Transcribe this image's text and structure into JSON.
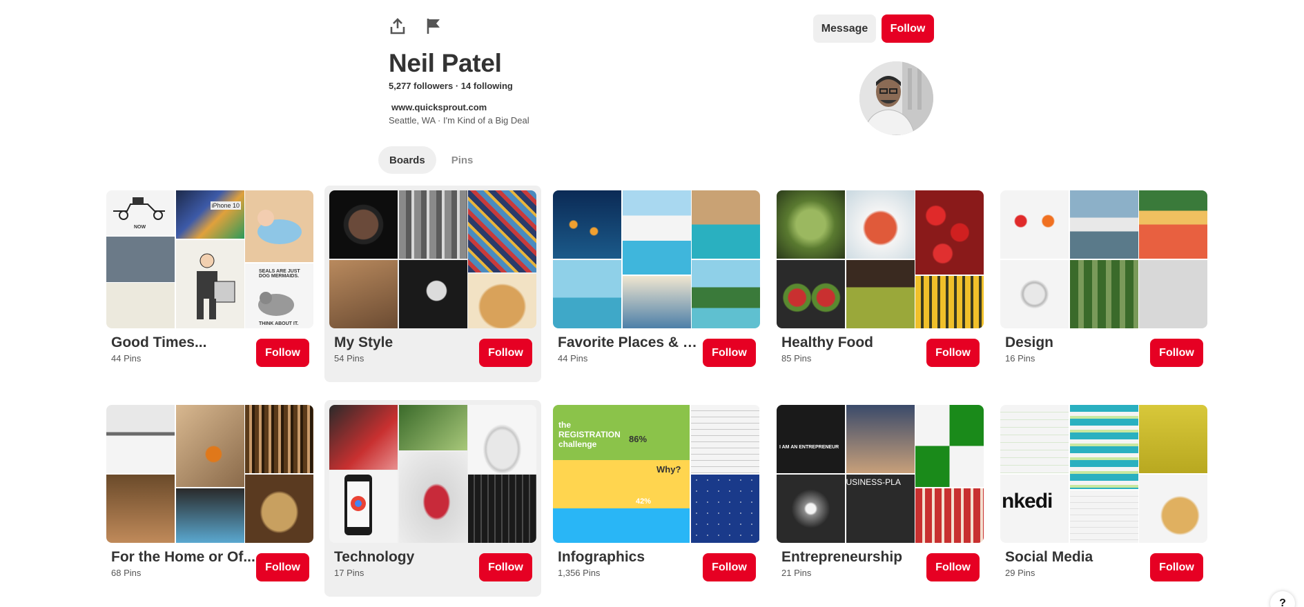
{
  "profile": {
    "name": "Neil Patel",
    "stats": "5,277 followers · 14 following",
    "website": "www.quicksprout.com",
    "location_about": "Seattle, WA  ·  I'm Kind of a Big Deal"
  },
  "header": {
    "share_icon": "share-icon",
    "report_icon": "flag-icon",
    "message_label": "Message",
    "follow_label": "Follow"
  },
  "tabs": [
    {
      "label": "Boards",
      "active": true
    },
    {
      "label": "Pins",
      "active": false
    }
  ],
  "boards": [
    {
      "title": "Good Times...",
      "count": "44 Pins",
      "follow": "Follow",
      "cover_text": [
        "NOW",
        "iPhone 10",
        "SEALS ARE JUST DOG MERMAIDS.",
        "THINK ABOUT IT."
      ]
    },
    {
      "title": "My Style",
      "count": "54 Pins",
      "follow": "Follow"
    },
    {
      "title": "Favorite Places & S...",
      "count": "44 Pins",
      "follow": "Follow"
    },
    {
      "title": "Healthy Food",
      "count": "85 Pins",
      "follow": "Follow"
    },
    {
      "title": "Design",
      "count": "16 Pins",
      "follow": "Follow"
    },
    {
      "title": "For the Home or Of...",
      "count": "68 Pins",
      "follow": "Follow"
    },
    {
      "title": "Technology",
      "count": "17 Pins",
      "follow": "Follow"
    },
    {
      "title": "Infographics",
      "count": "1,356 Pins",
      "follow": "Follow",
      "cover_text": [
        "the REGISTRATION challenge",
        "86%",
        "Why?",
        "42%"
      ]
    },
    {
      "title": "Entrepreneurship",
      "count": "21 Pins",
      "follow": "Follow",
      "cover_text": [
        "I AM AN ENTREPRENEUR",
        "USINESS-PLA"
      ]
    },
    {
      "title": "Social Media",
      "count": "29 Pins",
      "follow": "Follow",
      "cover_text": [
        "nkedi"
      ]
    }
  ],
  "help_label": "?",
  "colors": {
    "accent": "#e60023",
    "button_gray": "#efefef",
    "text": "#333333"
  }
}
